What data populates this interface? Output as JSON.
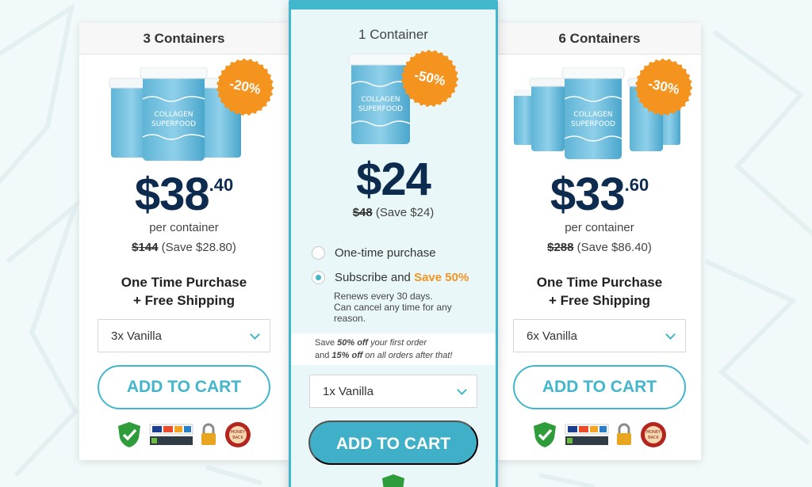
{
  "colors": {
    "accent": "#41b6cd",
    "badge_orange": "#f5931f",
    "price_navy": "#0d2b4e"
  },
  "left": {
    "header": "3 Containers",
    "badge": "-20%",
    "price_dollars": "$38",
    "price_cents": ".40",
    "per_container": "per container",
    "compare_price": "$144",
    "compare_save": "(Save $28.80)",
    "purchase_line1": "One Time Purchase",
    "purchase_line2": "+ Free Shipping",
    "select_value": "3x Vanilla",
    "cta": "ADD TO CART",
    "trust_icons": [
      "shield-check-icon",
      "payment-cards-icon",
      "lock-icon",
      "money-back-icon"
    ]
  },
  "middle": {
    "header": "1 Container",
    "badge": "-50%",
    "price": "$24",
    "compare_price": "$48",
    "compare_save": "(Save $24)",
    "option_one_time": "One-time purchase",
    "option_subscribe": "Subscribe and",
    "option_subscribe_save": "Save 50%",
    "selected_option": "subscribe",
    "renew_line1": "Renews every 30 days.",
    "renew_line2": "Can cancel any time for any",
    "renew_line3": "reason.",
    "promo_a": "Save",
    "promo_b": "50% off",
    "promo_c": "your first order",
    "promo_d": "and",
    "promo_e": "15% off",
    "promo_f": "on all orders after that!",
    "select_value": "1x Vanilla",
    "cta": "ADD TO CART"
  },
  "right": {
    "header": "6 Containers",
    "badge": "-30%",
    "price_dollars": "$33",
    "price_cents": ".60",
    "per_container": "per container",
    "compare_price": "$288",
    "compare_save": "(Save $86.40)",
    "purchase_line1": "One Time Purchase",
    "purchase_line2": "+ Free Shipping",
    "select_value": "6x Vanilla",
    "cta": "ADD TO CART"
  }
}
